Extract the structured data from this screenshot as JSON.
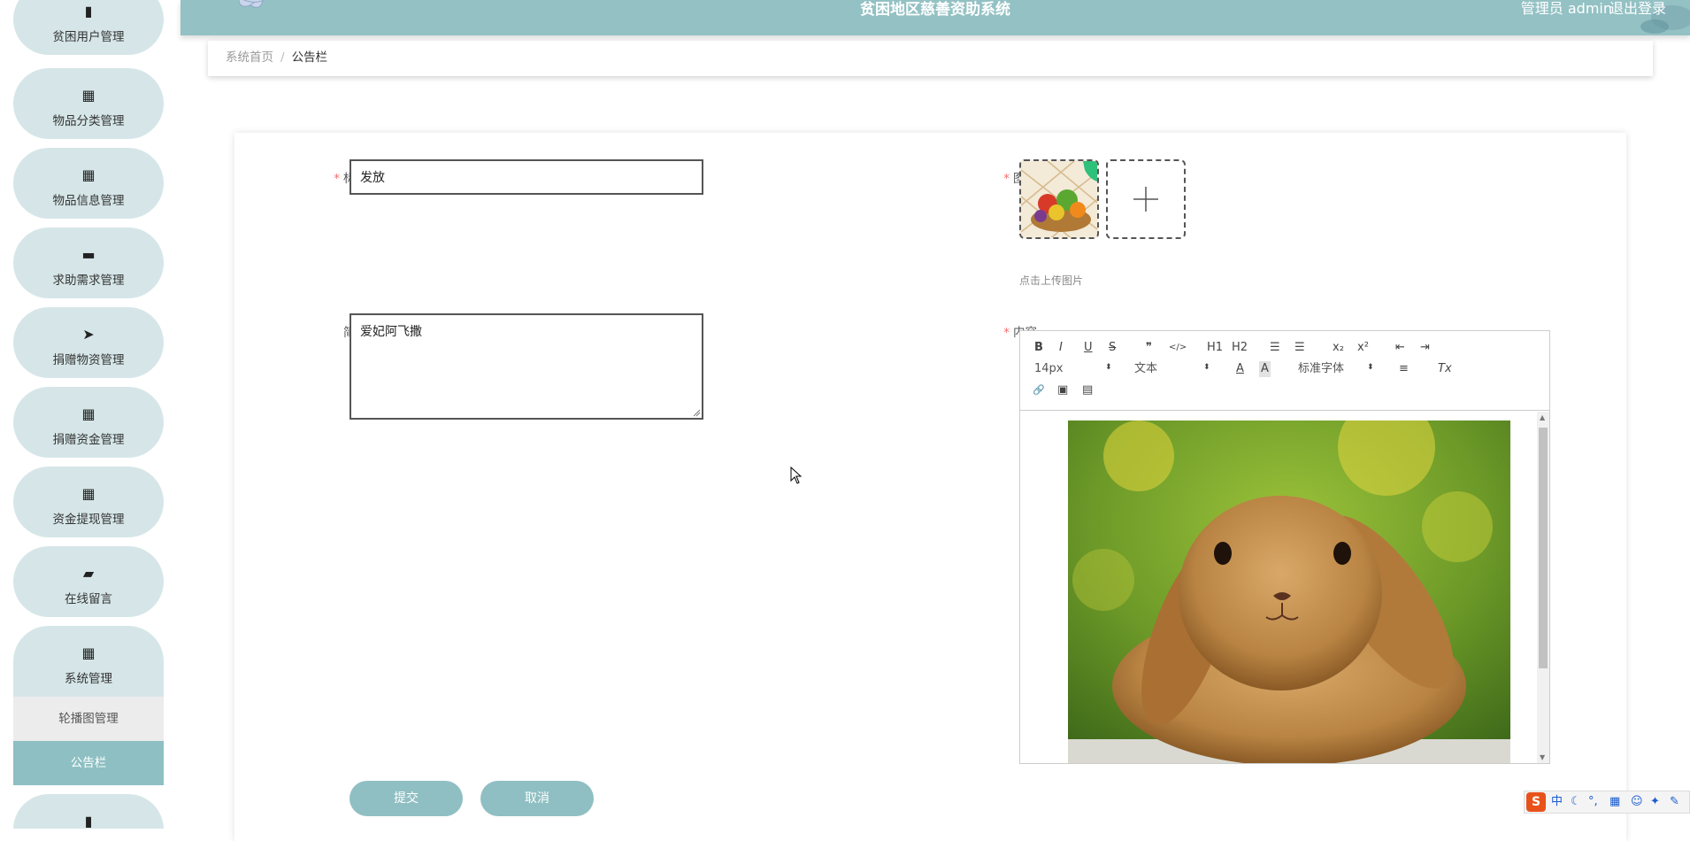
{
  "header": {
    "title": "贫困地区慈善资助系统",
    "user": "管理员 admin",
    "logout": "退出登录"
  },
  "sidebar": {
    "items": [
      {
        "icon": "clipboard-icon",
        "glyph": "▮",
        "label": "贫困用户管理"
      },
      {
        "icon": "grid-icon",
        "glyph": "▦",
        "label": "物品分类管理"
      },
      {
        "icon": "grid-icon",
        "glyph": "▦",
        "label": "物品信息管理"
      },
      {
        "icon": "monitor-icon",
        "glyph": "▬",
        "label": "求助需求管理"
      },
      {
        "icon": "send-icon",
        "glyph": "➤",
        "label": "捐赠物资管理"
      },
      {
        "icon": "grid-icon",
        "glyph": "▦",
        "label": "捐赠资金管理"
      },
      {
        "icon": "grid-icon",
        "glyph": "▦",
        "label": "资金提现管理"
      },
      {
        "icon": "briefcase-icon",
        "glyph": "▰",
        "label": "在线留言"
      },
      {
        "icon": "grid-icon",
        "glyph": "▦",
        "label": "系统管理"
      }
    ],
    "submenu": [
      {
        "label": "轮播图管理"
      },
      {
        "label": "公告栏",
        "active": true
      }
    ],
    "last_icon": "clipboard-icon",
    "last_glyph": "▮"
  },
  "breadcrumb": {
    "home": "系统首页",
    "separator": "/",
    "current": "公告栏"
  },
  "form": {
    "title_label": "标题",
    "title_value": "发放",
    "intro_label": "简介",
    "intro_value": "爱妃阿飞撒",
    "image_label": "图片",
    "upload_hint": "点击上传图片",
    "upload_plus": "+",
    "content_label": "内容",
    "submit_label": "提交",
    "cancel_label": "取消"
  },
  "editor": {
    "toolbar": {
      "bold": "B",
      "italic": "I",
      "underline": "U",
      "strike": "S",
      "quote": "❞",
      "code": "</>",
      "h1": "H1",
      "h2": "H2",
      "ordered_list": "☰",
      "bullet_list": "☰",
      "subscript": "x₂",
      "superscript": "x²",
      "outdent": "⇤",
      "indent": "⇥",
      "font_size": "14px",
      "paragraph": "文本",
      "font_color": "A",
      "bg_color": "A",
      "font_family": "标准字体",
      "align": "≡",
      "clean": "Tx",
      "link": "🔗",
      "image": "▣",
      "video": "▤"
    }
  },
  "ime": {
    "logo": "S",
    "lang": "中",
    "moon": "☾",
    "punct": "°,",
    "keyboard": "▦",
    "shirt": "✦",
    "wrench": "✎"
  },
  "colors": {
    "theme": "#93c1c4",
    "menu_bg": "#d6e6e8",
    "active_sub": "#8dbfc3",
    "required": "#f56c6c"
  }
}
